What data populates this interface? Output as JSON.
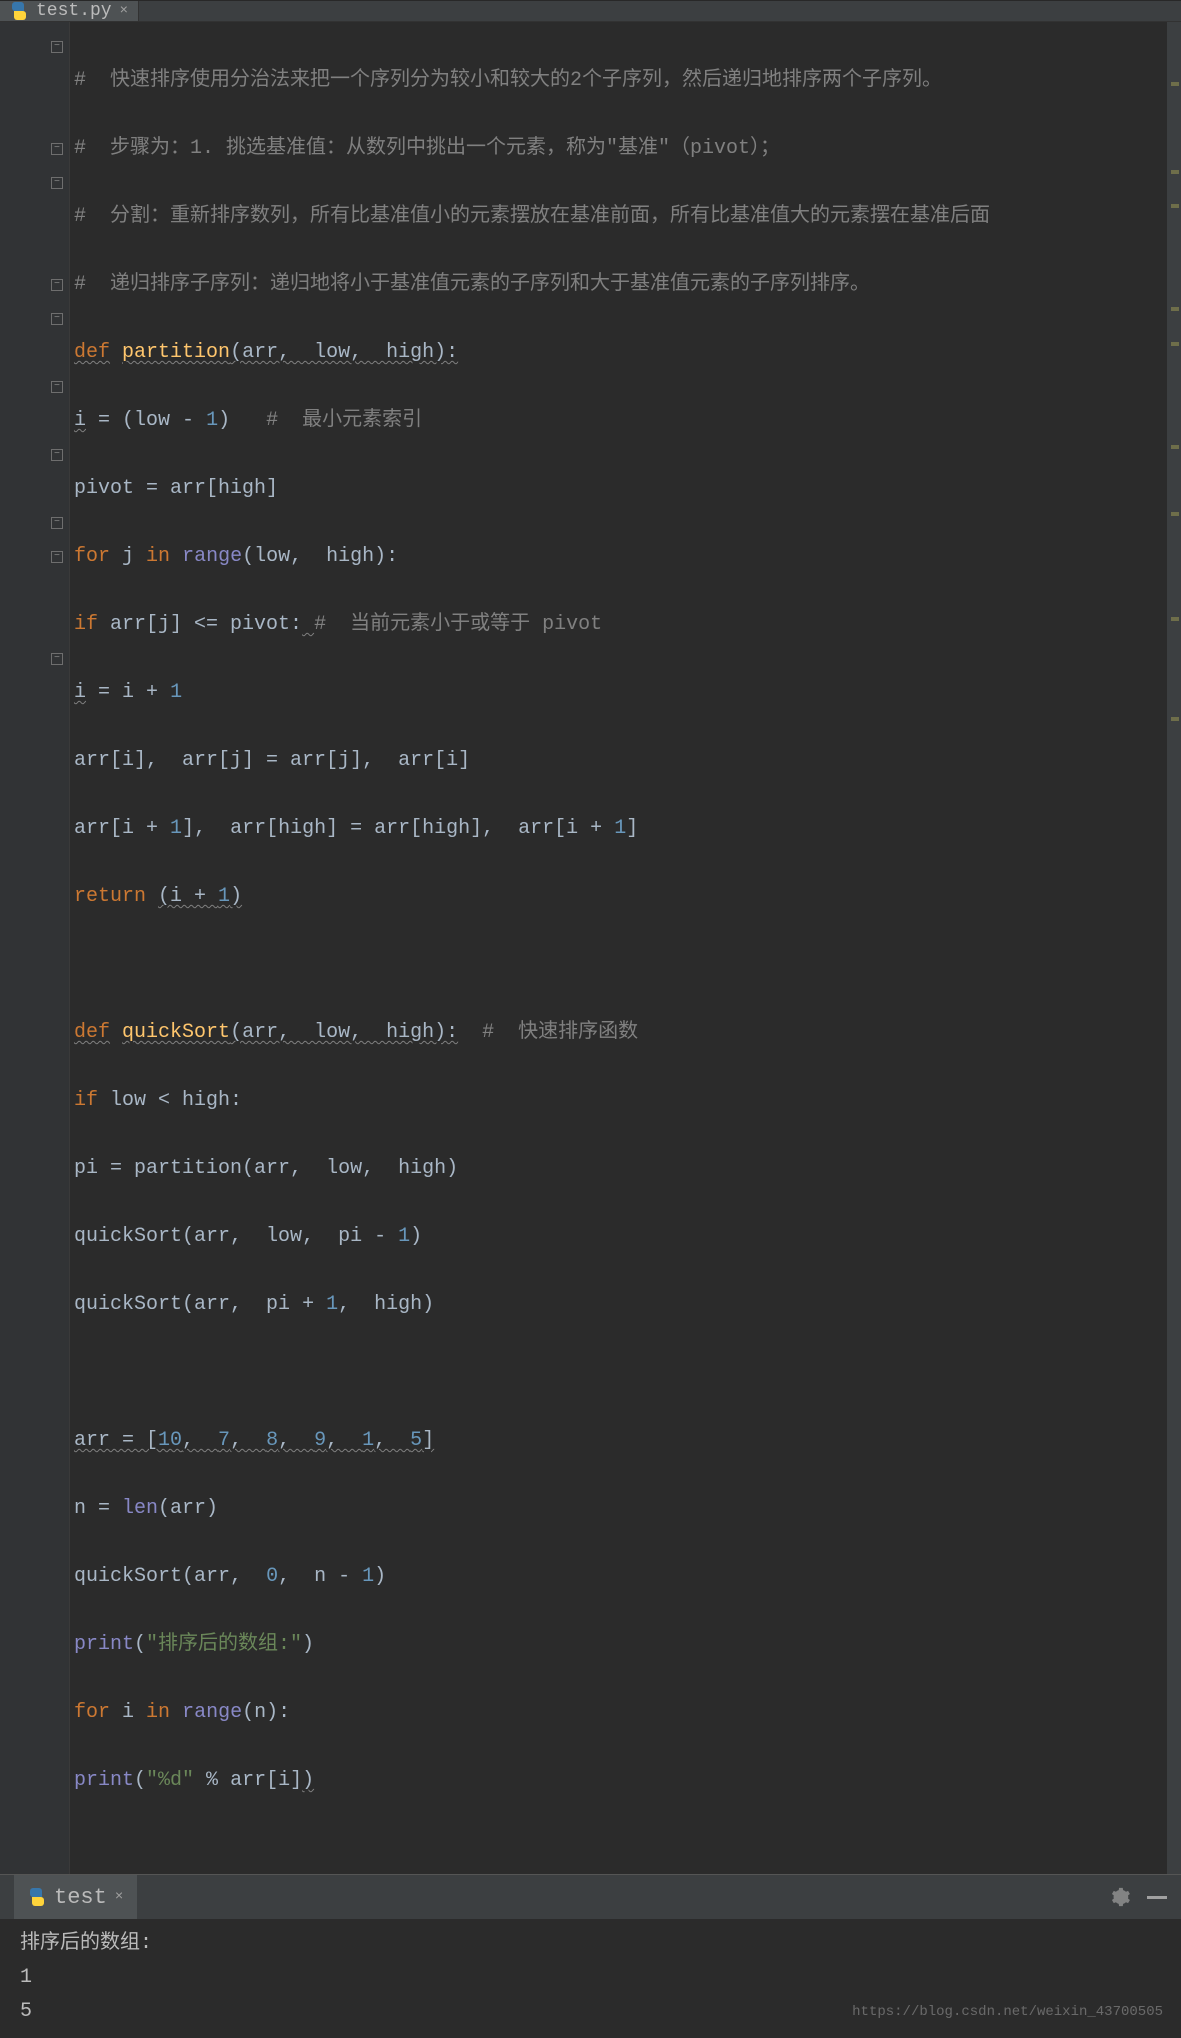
{
  "tab": {
    "filename": "test.py",
    "close": "×"
  },
  "code": {
    "c1_p1": "#  快速排序使用分治法来把一个序列分为较小和较大的2个子序列，然后递归地排序两个子序列。",
    "c2_p1": "#  步骤为：1. 挑选基准值：从数列中挑出一个元素，称为\"基准\"（pivot）；",
    "c3_p1": "#  分割：重新排序数列，所有比基准值小的元素摆放在基准前面，所有比基准值大的元素摆在基准后面",
    "c4_p1": "#  递归排序子序列：递归地将小于基准值元素的子序列和大于基准值元素的子序列排序。",
    "def": "def",
    "partition": "partition",
    "lp": "(",
    "arr": "arr",
    "comma": ",",
    "sp": " ",
    "low": "low",
    "high": "high",
    "rp": ")",
    "colon": ":",
    "i_var": "i",
    "eq": " = ",
    "one": "1",
    "minus": "-",
    "pivot_cm": "#  最小元素索引",
    "pivot_var": "pivot",
    "lb": "[",
    "rb": "]",
    "for": "for",
    "j_var": "j",
    "in": "in",
    "range": "range",
    "if": "if",
    "lte": " <= ",
    "pivot_if_cm": "#  当前元素小于或等于 pivot",
    "plus": "+",
    "return": "return",
    "quickSort": "quickSort",
    "qs_cm": "#  快速排序函数",
    "lt": " < ",
    "pi_var": "pi",
    "arr_lit_o": "[",
    "ten": "10",
    "seven": "7",
    "eight": "8",
    "nine": "9",
    "five": "5",
    "arr_lit_c": "]",
    "n_var": "n",
    "len": "len",
    "zero": "0",
    "print": "print",
    "str1": "\"排序后的数组:\"",
    "range2": "range",
    "str2": "\"%d\"",
    "pct": " % "
  },
  "console": {
    "tab_name": "test",
    "close": "×",
    "out1": "排序后的数组:",
    "out2": "1",
    "out3": "5"
  },
  "watermark": "https://blog.csdn.net/weixin_43700505"
}
